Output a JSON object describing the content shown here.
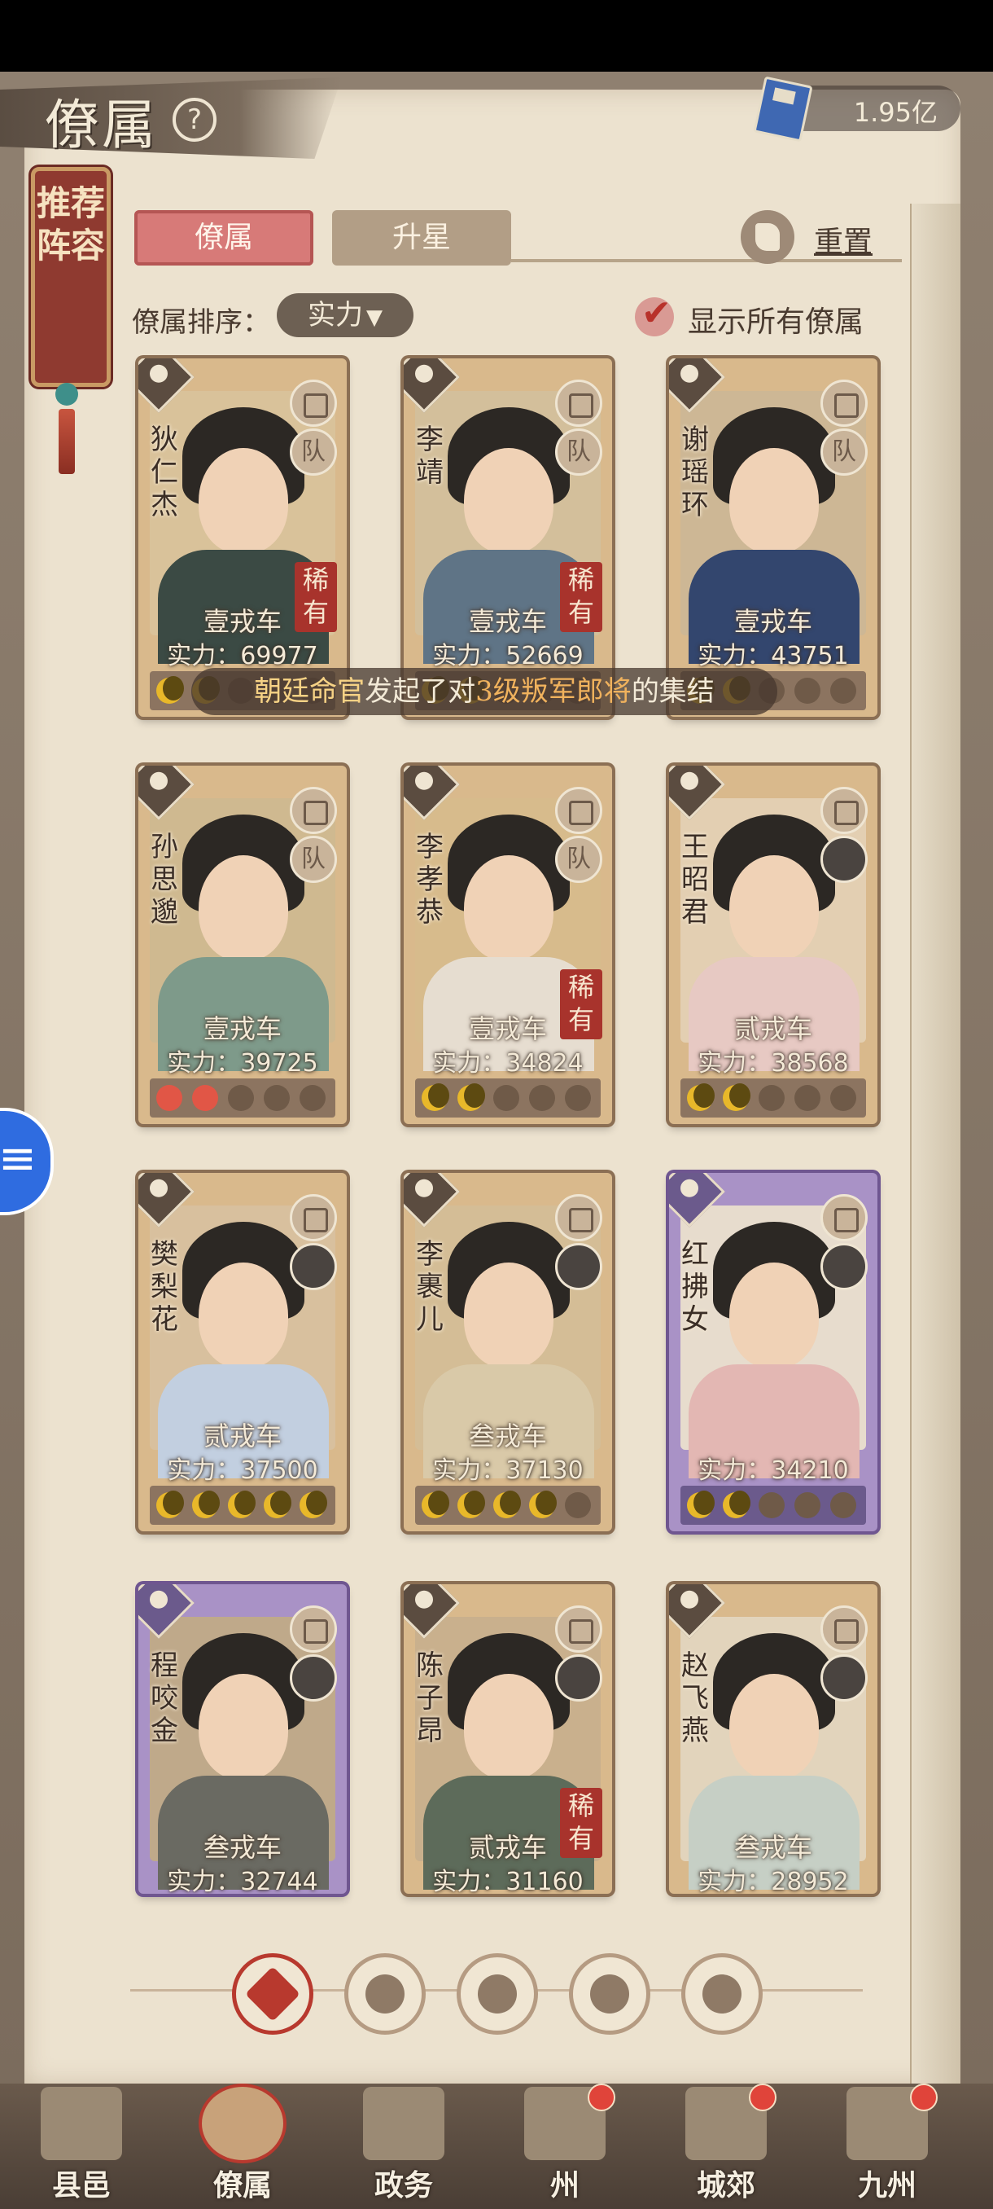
{
  "header": {
    "title": "僚属",
    "help_icon": "question-icon",
    "currency_value": "1.95亿",
    "currency_icon": "book-icon"
  },
  "recommend": {
    "label": "推荐阵容"
  },
  "tabs": [
    {
      "label": "僚属",
      "active": true
    },
    {
      "label": "升星",
      "active": false
    }
  ],
  "reset_label": "重置",
  "sort": {
    "label": "僚属排序：",
    "value": "实力"
  },
  "show_all": {
    "label": "显示所有僚属",
    "checked": true
  },
  "notice": {
    "part1": "朝廷命官",
    "part2": "发起了对",
    "part3": "3级叛军郎将",
    "part4": "的集结"
  },
  "power_prefix": "实力：",
  "rare_label": "稀有",
  "team_label": "队",
  "cards": [
    {
      "name": "狄仁杰",
      "grade": "壹戎车",
      "power": "69977",
      "rare": true,
      "team": true,
      "upgrade": false,
      "stars": [
        1,
        1,
        0,
        0,
        0
      ],
      "purple": false,
      "robe": "#3b4a44",
      "bg": "#d9c29a"
    },
    {
      "name": "李靖",
      "grade": "壹戎车",
      "power": "52669",
      "rare": true,
      "team": true,
      "upgrade": true,
      "stars": [
        1,
        1,
        0,
        0,
        0
      ],
      "purple": false,
      "robe": "#5f7486",
      "bg": "#d3bf9b"
    },
    {
      "name": "谢瑶环",
      "grade": "壹戎车",
      "power": "43751",
      "rare": false,
      "team": true,
      "upgrade": true,
      "stars": [
        1,
        1,
        0,
        0,
        0
      ],
      "purple": false,
      "robe": "#33466e",
      "bg": "#cdb795"
    },
    {
      "name": "孙思邈",
      "grade": "壹戎车",
      "power": "39725",
      "rare": false,
      "team": true,
      "upgrade": true,
      "stars": [
        2,
        2,
        0,
        0,
        0
      ],
      "purple": false,
      "robe": "#7e9a8a",
      "bg": "#cfb990"
    },
    {
      "name": "李孝恭",
      "grade": "壹戎车",
      "power": "34824",
      "rare": true,
      "team": true,
      "upgrade": false,
      "stars": [
        1,
        1,
        0,
        0,
        0
      ],
      "purple": false,
      "robe": "#e6ddd0",
      "bg": "#d7bb8c"
    },
    {
      "name": "王昭君",
      "grade": "贰戎车",
      "power": "38568",
      "rare": false,
      "team": false,
      "upgrade": false,
      "stars": [
        1,
        1,
        0,
        0,
        0
      ],
      "purple": false,
      "robe": "#e7c9c3",
      "bg": "#e3cfb2"
    },
    {
      "name": "樊梨花",
      "grade": "贰戎车",
      "power": "37500",
      "rare": false,
      "team": false,
      "upgrade": false,
      "stars": [
        1,
        1,
        1,
        1,
        1
      ],
      "purple": false,
      "robe": "#c2cfe0",
      "bg": "#d8c09e"
    },
    {
      "name": "李裹儿",
      "grade": "叁戎车",
      "power": "37130",
      "rare": false,
      "team": false,
      "upgrade": false,
      "stars": [
        1,
        1,
        1,
        1,
        0
      ],
      "purple": false,
      "robe": "#d9c9a8",
      "bg": "#d4bd96"
    },
    {
      "name": "红拂女",
      "grade": "",
      "power": "34210",
      "rare": false,
      "team": false,
      "upgrade": false,
      "stars": [
        1,
        1,
        0,
        0,
        0
      ],
      "purple": true,
      "robe": "#e3b7b3",
      "bg": "#e7dccd"
    },
    {
      "name": "程咬金",
      "grade": "叁戎车",
      "power": "32744",
      "rare": false,
      "team": false,
      "upgrade": false,
      "stars": [],
      "purple": true,
      "robe": "#6a6a62",
      "bg": "#bfa98a"
    },
    {
      "name": "陈子昂",
      "grade": "贰戎车",
      "power": "31160",
      "rare": true,
      "team": false,
      "upgrade": false,
      "stars": [],
      "purple": false,
      "robe": "#5d6b5a",
      "bg": "#c9b08d"
    },
    {
      "name": "赵飞燕",
      "grade": "叁戎车",
      "power": "28952",
      "rare": false,
      "team": false,
      "upgrade": false,
      "stars": [],
      "purple": false,
      "robe": "#c6cfc5",
      "bg": "#e2d4bc"
    }
  ],
  "filters": [
    {
      "icon": "all-filter-icon",
      "active": true
    },
    {
      "icon": "helmet-filter-icon",
      "active": false
    },
    {
      "icon": "gourd-filter-icon",
      "active": false
    },
    {
      "icon": "fan-filter-icon",
      "active": false
    },
    {
      "icon": "lion-filter-icon",
      "active": false
    }
  ],
  "nav": [
    {
      "label": "县邑",
      "active": false,
      "dot": false
    },
    {
      "label": "僚属",
      "active": true,
      "dot": false
    },
    {
      "label": "政务",
      "active": false,
      "dot": false
    },
    {
      "label": "州",
      "active": false,
      "dot": true
    },
    {
      "label": "城郊",
      "active": false,
      "dot": true
    },
    {
      "label": "九州",
      "active": false,
      "dot": true
    }
  ]
}
